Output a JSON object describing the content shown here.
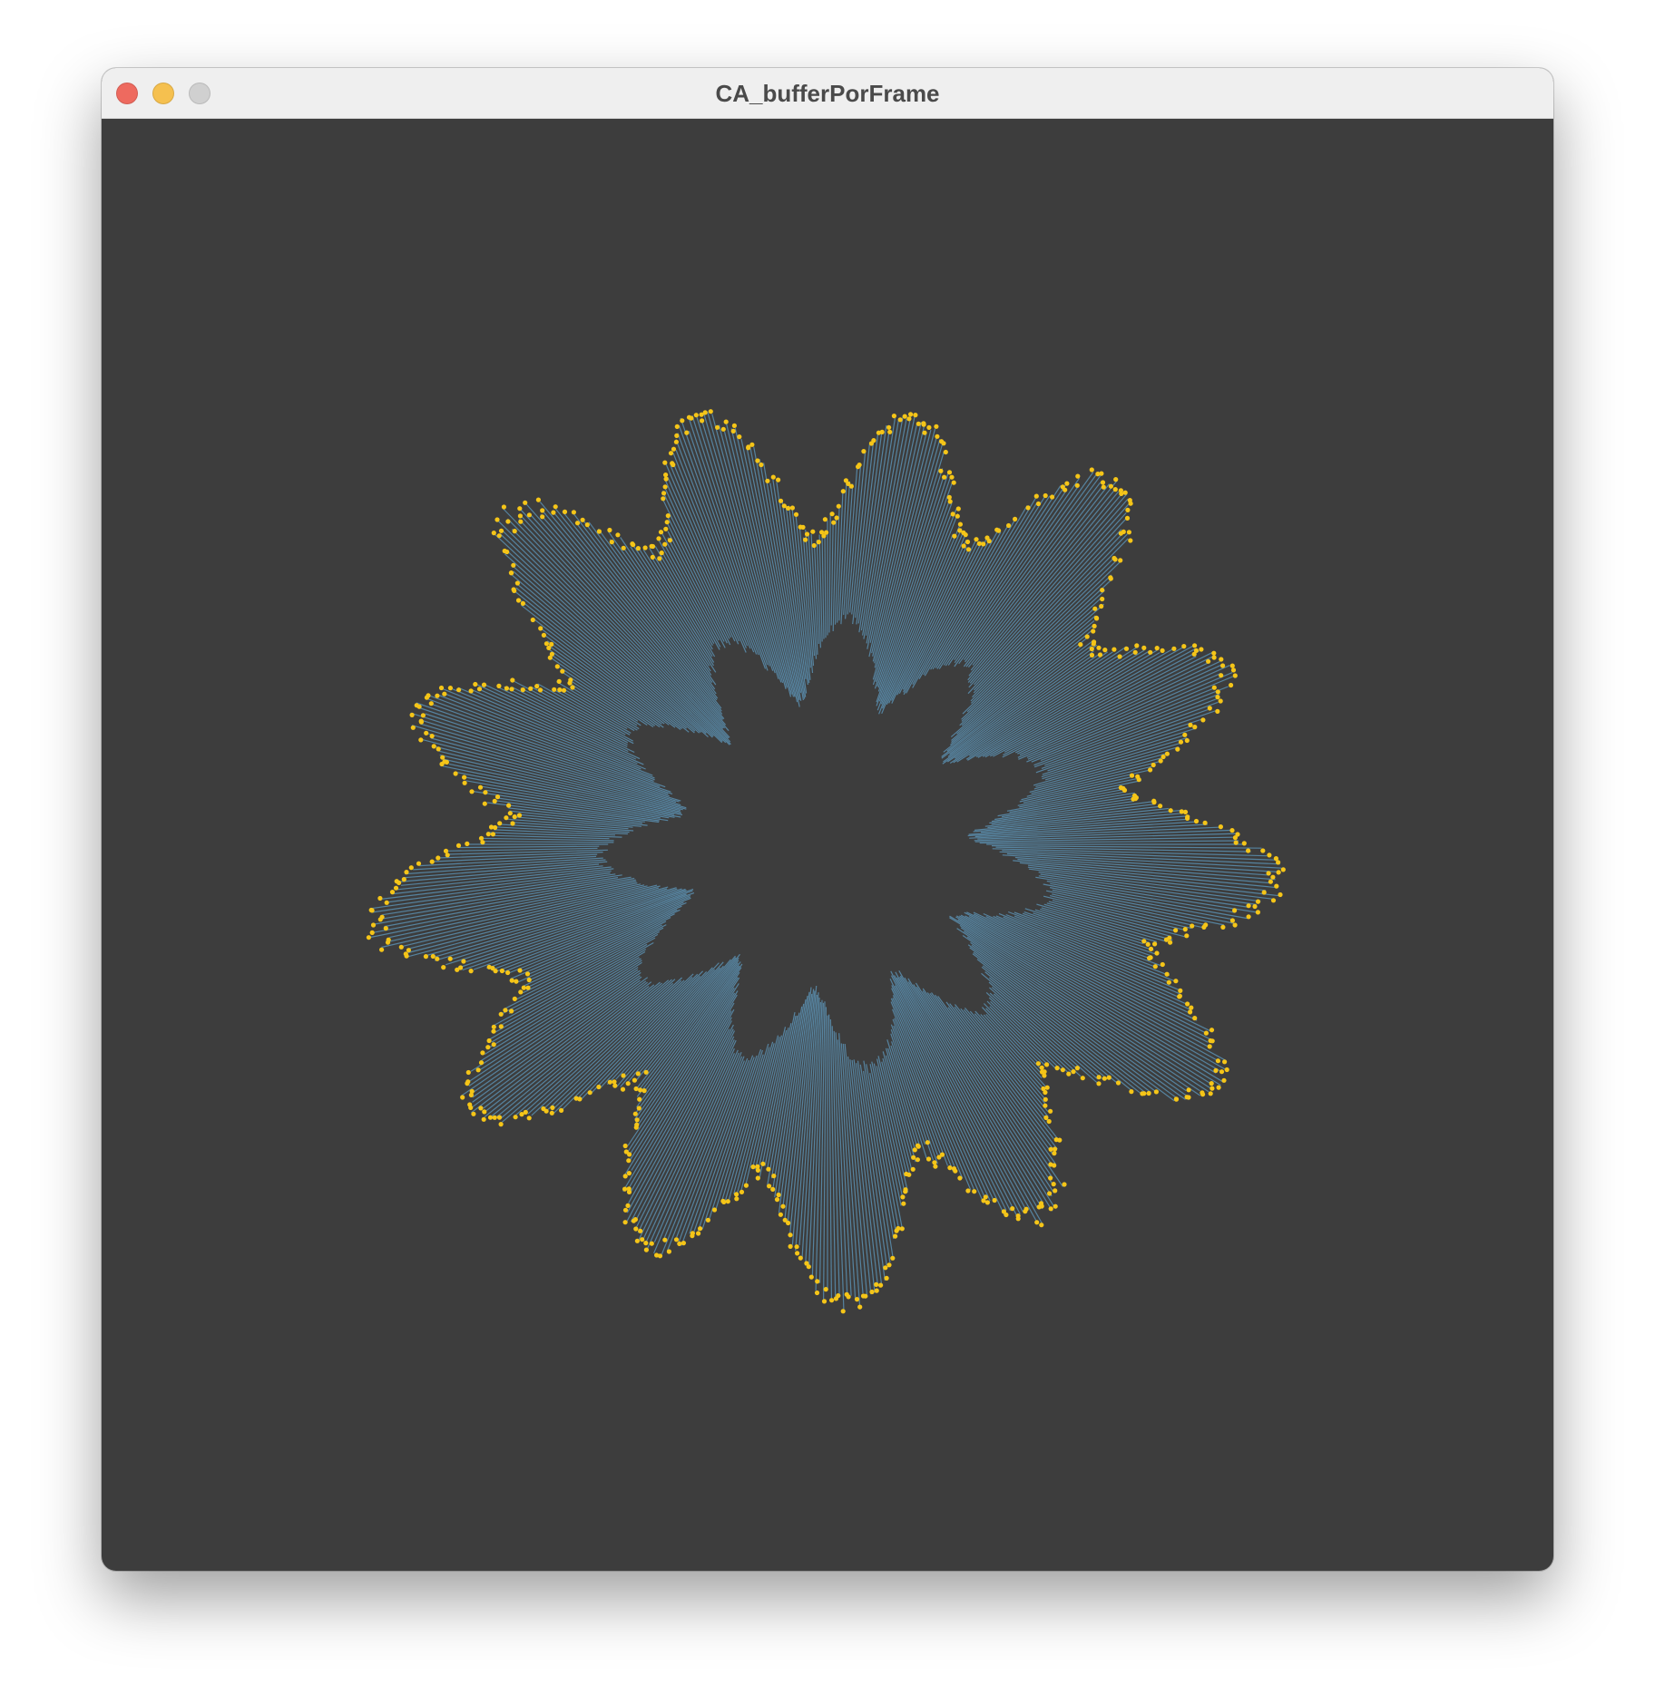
{
  "window": {
    "title": "CA_bufferPorFrame",
    "traffic_lights": [
      {
        "name": "close-button",
        "color": "#ee6a5f"
      },
      {
        "name": "minimize-button",
        "color": "#f5c04f"
      },
      {
        "name": "zoom-button",
        "color": "#d0d0d0"
      }
    ]
  },
  "sketch": {
    "background": "#3d3d3d",
    "ray_color": "#5b8fb0",
    "dot_color": "#f5c518",
    "shape": "radial burst of lines from an inner ring to an outer ring, with dots on the outer tips"
  }
}
